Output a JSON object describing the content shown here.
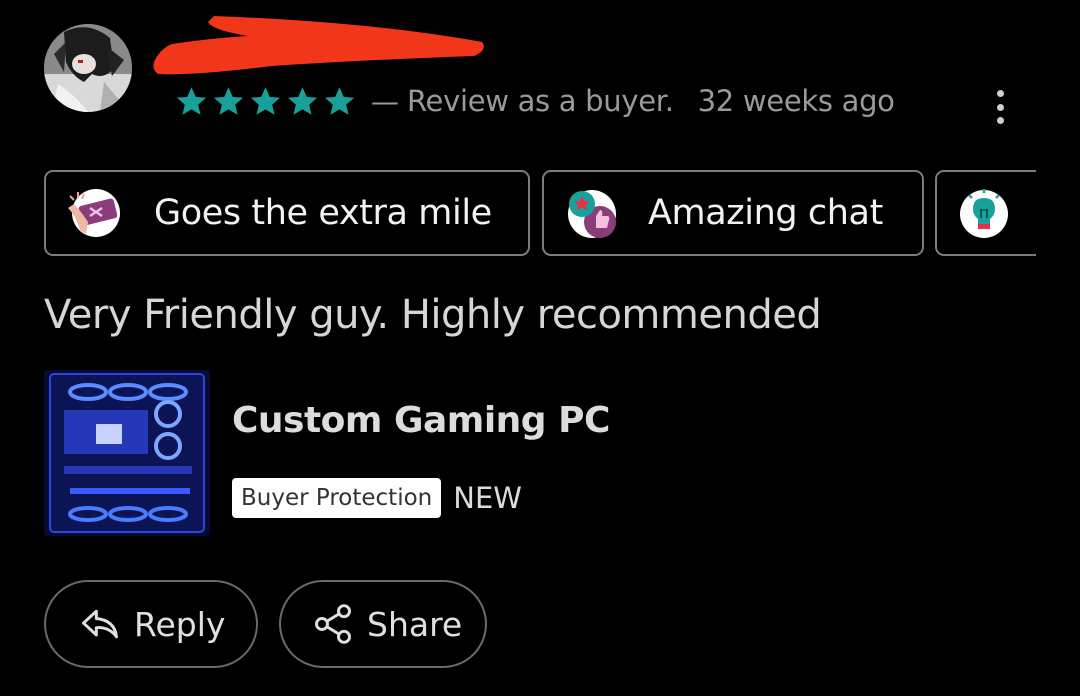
{
  "review": {
    "rating": 5,
    "rating_max": 5,
    "separator": "—",
    "role_text": "Review as a buyer.",
    "time_ago": "32 weeks ago",
    "comment": "Very Friendly guy. Highly recommended",
    "star_color": "#1aa09a"
  },
  "tags": [
    {
      "label": "Goes the extra mile",
      "icon": "extra-mile-icon"
    },
    {
      "label": "Amazing chat",
      "icon": "chat-thumbs-icon"
    },
    {
      "label": "",
      "icon": "lightbulb-icon"
    }
  ],
  "product": {
    "title": "Custom Gaming PC",
    "badge": "Buyer Protection",
    "condition": "NEW"
  },
  "actions": {
    "reply_label": "Reply",
    "share_label": "Share"
  },
  "colors": {
    "background": "#000000",
    "redaction": "#f2361a",
    "chip_border": "#7c7c7c"
  }
}
